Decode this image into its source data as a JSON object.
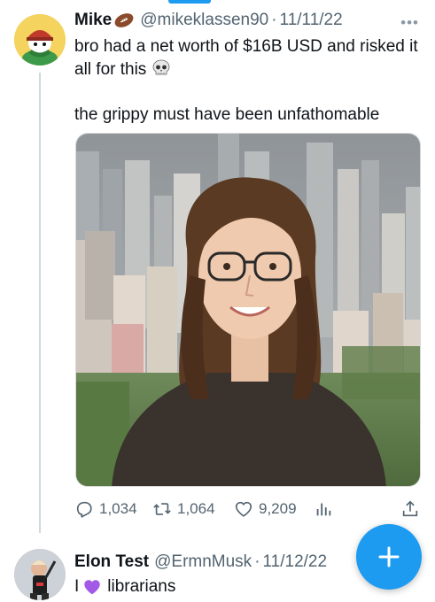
{
  "tweets": [
    {
      "author_name": "Mike",
      "author_emoji_icon": "american-football-icon",
      "handle": "@mikeklassen90",
      "separator": "·",
      "date": "11/11/22",
      "text_line_1": "bro had a net worth of $16B USD and risked it all for this",
      "text_emoji_icon": "skull-icon",
      "text_line_2": "the grippy must have been unfathomable",
      "media_icon": "photo-of-person-with-city-skyline",
      "actions": {
        "replies": "1,034",
        "retweets": "1,064",
        "likes": "9,209"
      }
    },
    {
      "author_name": "Elon Test",
      "handle": "@ErmnMusk",
      "separator": "·",
      "date": "11/12/22",
      "text_prefix": "I",
      "text_emoji_icon": "purple-heart-icon",
      "text_suffix": "librarians"
    }
  ],
  "colors": {
    "accent": "#1d9bf0",
    "secondary_text": "#536471",
    "thread_line": "#cfd9de",
    "purple_heart": "#a259e6"
  }
}
